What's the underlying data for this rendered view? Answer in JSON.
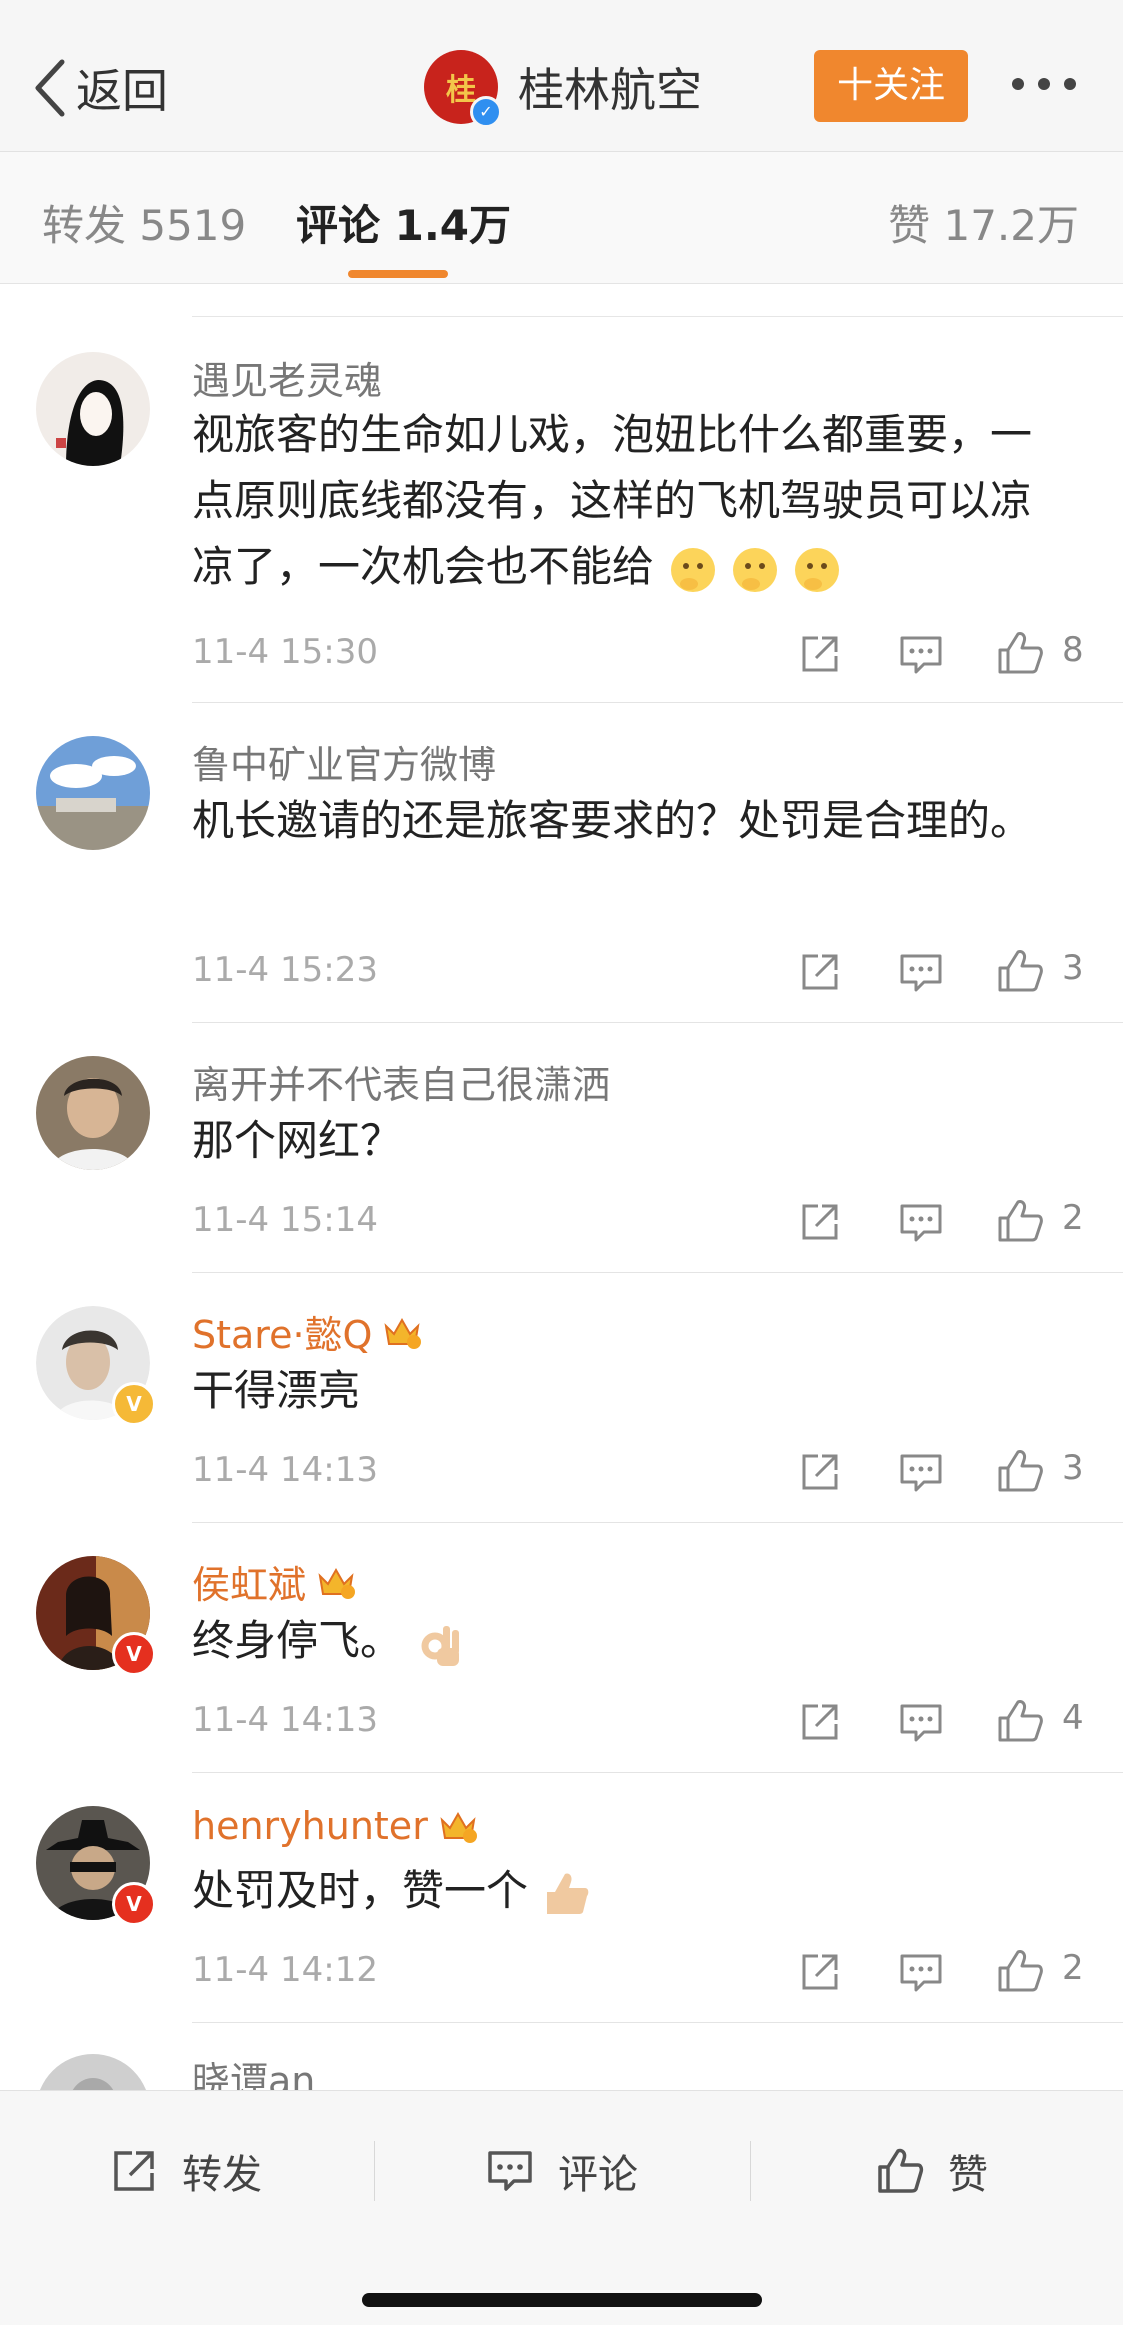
{
  "nav": {
    "back_label": "返回",
    "account_name": "桂林航空",
    "follow_label": "十关注"
  },
  "tabs": [
    {
      "label": "转发 5519"
    },
    {
      "label": "评论 1.4万"
    },
    {
      "label": "赞 17.2万"
    }
  ],
  "comments": [
    {
      "user": "遇见老灵魂",
      "text": "视旅客的生命如儿戏，泡妞比什么都重要，一点原则底线都没有，这样的飞机驾驶员可以凉凉了，一次机会也不能给",
      "time": "11-4 15:30",
      "likes": "8"
    },
    {
      "user": "鲁中矿业官方微博",
      "text": "机长邀请的还是旅客要求的？处罚是合理的。",
      "time": "11-4 15:23",
      "likes": "3"
    },
    {
      "user": "离开并不代表自己很潇洒",
      "text": "那个网红？",
      "time": "11-4 15:14",
      "likes": "2"
    },
    {
      "user": "Stare·懿Q",
      "text": "干得漂亮",
      "time": "11-4 14:13",
      "likes": "3"
    },
    {
      "user": "侯虹斌",
      "text": "终身停飞。",
      "time": "11-4 14:13",
      "likes": "4"
    },
    {
      "user": "henryhunter",
      "text": "处罚及时，赞一个",
      "time": "11-4 14:12",
      "likes": "2"
    },
    {
      "user": "晓谭an"
    }
  ],
  "bottom": {
    "repost_label": "转发",
    "comment_label": "评论",
    "like_label": "赞"
  },
  "colors": {
    "accent": "#f0872e",
    "vip_name": "#e0722b",
    "badge_yellow": "#f5b937",
    "badge_red": "#e5301f"
  }
}
